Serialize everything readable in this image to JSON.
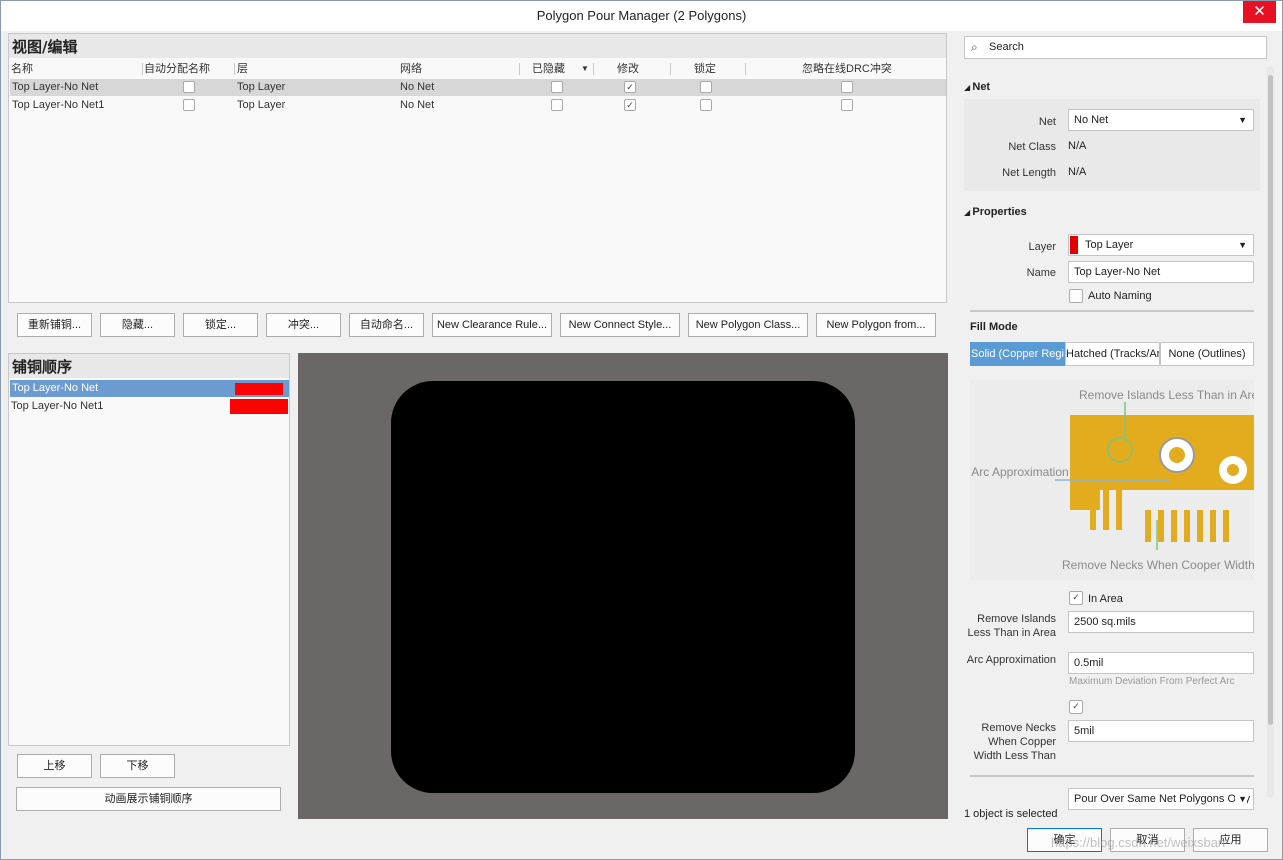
{
  "window": {
    "title": "Polygon Pour Manager (2 Polygons)",
    "close": "✕"
  },
  "view_edit": {
    "header": "视图/编辑",
    "columns": [
      "名称",
      "自动分配名称",
      "层",
      "网络",
      "已隐藏",
      "修改",
      "锁定",
      "忽略在线DRC冲突"
    ],
    "rows": [
      {
        "name": "Top Layer-No Net",
        "layer": "Top Layer",
        "net": "No Net",
        "auto_name": false,
        "hidden": false,
        "modify": true,
        "locked": false,
        "ignore_drc": false
      },
      {
        "name": "Top Layer-No Net1",
        "layer": "Top Layer",
        "net": "No Net",
        "auto_name": false,
        "hidden": false,
        "modify": true,
        "locked": false,
        "ignore_drc": false
      }
    ]
  },
  "action_buttons": [
    "重新铺铜...",
    "隐藏...",
    "锁定...",
    "冲突...",
    "自动命名...",
    "New Clearance Rule...",
    "New Connect Style...",
    "New Polygon Class...",
    "New Polygon from..."
  ],
  "pour_order": {
    "header": "铺铜顺序",
    "items": [
      {
        "name": "Top Layer-No Net",
        "color": "#ff0000",
        "selected": true
      },
      {
        "name": "Top Layer-No Net1",
        "color": "#ff0000",
        "selected": false
      }
    ],
    "move_up": "上移",
    "move_down": "下移",
    "animate": "动画展示铺铜顺序"
  },
  "right_panel": {
    "search_placeholder": "Search",
    "net_section": "Net",
    "net_label": "Net",
    "net_value": "No Net",
    "net_class_label": "Net Class",
    "net_class_value": "N/A",
    "net_length_label": "Net Length",
    "net_length_value": "N/A",
    "properties_section": "Properties",
    "layer_label": "Layer",
    "layer_value": "Top Layer",
    "layer_color": "#e00000",
    "name_label": "Name",
    "name_value": "Top Layer-No Net",
    "auto_naming": "Auto Naming",
    "fill_mode_section": "Fill Mode",
    "fill_tabs": [
      "Solid (Copper Regions)",
      "Hatched (Tracks/Arcs)",
      "None (Outlines)"
    ],
    "diagram": {
      "remove_islands": "Remove Islands Less Than in Area",
      "arc_approx": "Arc Approximation",
      "remove_necks": "Remove Necks When Cooper Width"
    },
    "in_area": "In Area",
    "remove_islands_label": "Remove Islands Less Than in Area",
    "remove_islands_value": "2500 sq.mils",
    "arc_label": "Arc Approximation",
    "arc_value": "0.5mil",
    "arc_hint": "Maximum Deviation From Perfect Arc",
    "remove_necks_label": "Remove Necks When Copper Width Less Than",
    "remove_necks_value": "5mil",
    "pour_over_value": "Pour Over Same Net Polygons Only",
    "status": "1 object is selected"
  },
  "footer": {
    "ok": "确定",
    "cancel": "取消",
    "apply": "应用"
  },
  "watermark": "https://blog.csdn.net/weixsban"
}
